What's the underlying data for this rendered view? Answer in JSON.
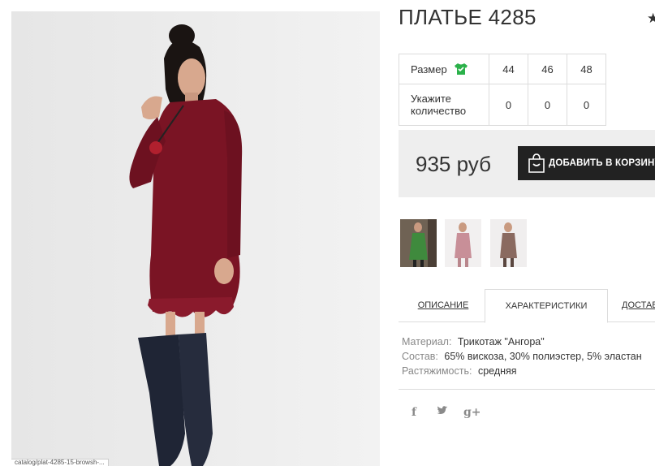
{
  "product": {
    "title": "ПЛАТЬЕ 4285",
    "favorite_icon": "star-icon",
    "image_alt": "model in burgundy dress",
    "status_url": "catalog/plat-4285-15-browsh-..."
  },
  "sizes": {
    "size_label": "Размер",
    "size_icon": "shirt-check-icon",
    "size_icon_color": "#2bb14a",
    "quantity_label": "Укажите количество",
    "options": [
      {
        "size": "44",
        "qty": "0"
      },
      {
        "size": "46",
        "qty": "0"
      },
      {
        "size": "48",
        "qty": "0"
      }
    ]
  },
  "purchase": {
    "price": "935 руб",
    "add_to_cart_label": "ДОБАВИТЬ В КОРЗИНУ",
    "cart_icon": "shopping-bag-icon"
  },
  "thumbnails": [
    {
      "name": "green",
      "color": "#3f8a3d"
    },
    {
      "name": "pink",
      "color": "#c88f98"
    },
    {
      "name": "mocha",
      "color": "#8a6a60"
    }
  ],
  "tabs": [
    {
      "label": "ОПИСАНИЕ",
      "active": false
    },
    {
      "label": "ХАРАКТЕРИСТИКИ",
      "active": true
    },
    {
      "label": "ДОСТАВКА",
      "active": false
    }
  ],
  "specs": [
    {
      "key": "Материал:",
      "value": "Трикотаж \"Ангора\""
    },
    {
      "key": "Состав:",
      "value": "65% вискоза, 30% полиэстер, 5% эластан"
    },
    {
      "key": "Растяжимость:",
      "value": "средняя"
    }
  ],
  "social": [
    {
      "icon": "facebook-icon",
      "glyph": "f"
    },
    {
      "icon": "twitter-icon",
      "glyph": "🐦"
    },
    {
      "icon": "google-plus-icon",
      "glyph": "g+"
    }
  ],
  "colors": {
    "dress": "#7a1424",
    "button_bg": "#222222",
    "price_bar_bg": "#eeeeee",
    "border": "#dcdcdc"
  }
}
